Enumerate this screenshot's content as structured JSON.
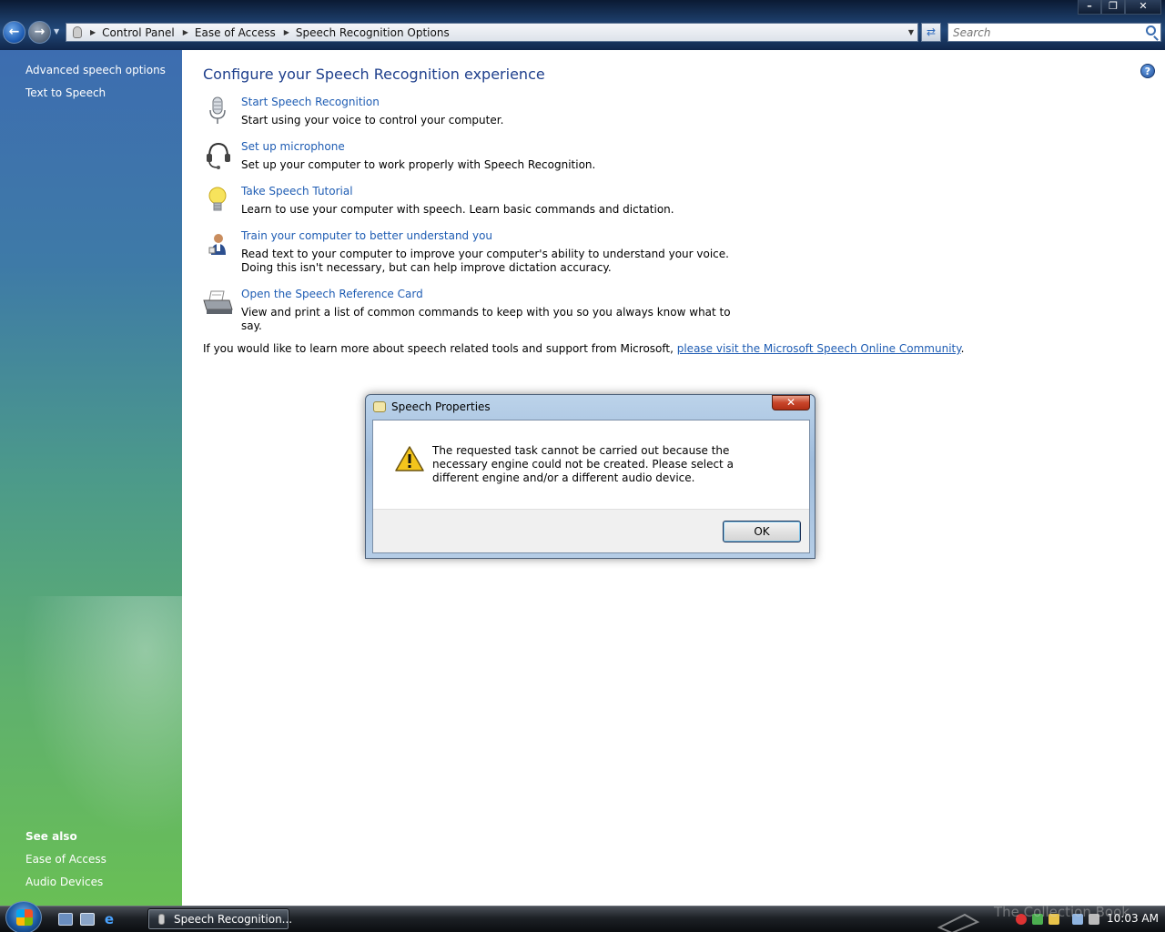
{
  "window": {
    "minimize_label": "–",
    "restore_label": "❐",
    "close_label": "✕"
  },
  "nav": {
    "back_icon": "←",
    "forward_icon": "→",
    "breadcrumbs": [
      "Control Panel",
      "Ease of Access",
      "Speech Recognition Options"
    ],
    "refresh_icon": "⇄",
    "search_placeholder": "Search"
  },
  "sidebar": {
    "tasks": [
      "Advanced speech options",
      "Text to Speech"
    ],
    "see_also_heading": "See also",
    "see_also": [
      "Ease of Access",
      "Audio Devices"
    ]
  },
  "main": {
    "title": "Configure your Speech Recognition experience",
    "help_label": "?",
    "tasks": [
      {
        "link": "Start Speech Recognition",
        "desc": "Start using your voice to control your computer.",
        "icon": "microphone-icon"
      },
      {
        "link": "Set up microphone",
        "desc": "Set up your computer to work properly with Speech Recognition.",
        "icon": "headset-icon"
      },
      {
        "link": "Take Speech Tutorial",
        "desc": "Learn to use your computer with speech.  Learn basic commands and dictation.",
        "icon": "lightbulb-icon"
      },
      {
        "link": "Train your computer to better understand you",
        "desc": "Read text to your computer to improve your computer's ability to understand your voice.  Doing this isn't necessary, but can help improve dictation accuracy.",
        "icon": "user-training-icon"
      },
      {
        "link": "Open the Speech Reference Card",
        "desc": "View and print a list of common commands to keep with you so you always know what to say.",
        "icon": "printer-icon"
      }
    ],
    "info_prefix": "If you would like to learn more about speech related tools and support from Microsoft, ",
    "info_link": "please visit the Microsoft Speech Online Community",
    "info_suffix": "."
  },
  "dialog": {
    "title": "Speech Properties",
    "close_label": "✕",
    "message": "The requested task cannot be carried out because the necessary engine could not be created.  Please select a different engine and/or a different audio device.",
    "ok_label": "OK"
  },
  "taskbar": {
    "window_button": "Speech Recognition...",
    "ie_glyph": "e",
    "clock": "10:03 AM",
    "watermark": "The Collection Book"
  },
  "colors": {
    "link": "#1e5cb3",
    "title": "#1e3f8c",
    "sidebar_top": "#3d6db0",
    "sidebar_bottom": "#69bf55"
  }
}
